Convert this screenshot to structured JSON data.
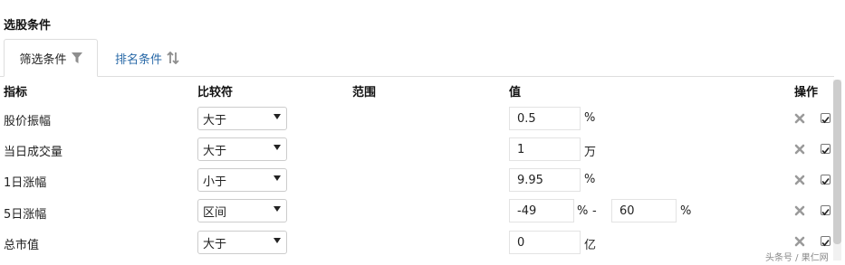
{
  "section_title": "选股条件",
  "tabs": [
    {
      "label": "筛选条件",
      "icon": "filter-icon",
      "active": true
    },
    {
      "label": "排名条件",
      "icon": "sort-icon",
      "active": false
    }
  ],
  "headers": {
    "indicator": "指标",
    "comparator": "比较符",
    "range": "范围",
    "value": "值",
    "action": "操作"
  },
  "rows": [
    {
      "label": "股价振幅",
      "comparator": "大于",
      "value": "0.5",
      "unit": "%",
      "checked": true
    },
    {
      "label": "当日成交量",
      "comparator": "大于",
      "value": "1",
      "unit": "万",
      "checked": true
    },
    {
      "label": "1日涨幅",
      "comparator": "小于",
      "value": "9.95",
      "unit": "%",
      "checked": true
    },
    {
      "label": "5日涨幅",
      "comparator": "区间",
      "value": "-49",
      "unit": "%",
      "range_sep": "-",
      "value2": "60",
      "unit2": "%",
      "checked": true
    },
    {
      "label": "总市值",
      "comparator": "大于",
      "value": "0",
      "unit": "亿",
      "checked": true
    }
  ],
  "watermark": "头条号 / 果仁网",
  "colors": {
    "link": "#2a6aa8",
    "icon_gray": "#9a9a9a",
    "border": "#dddddd"
  }
}
